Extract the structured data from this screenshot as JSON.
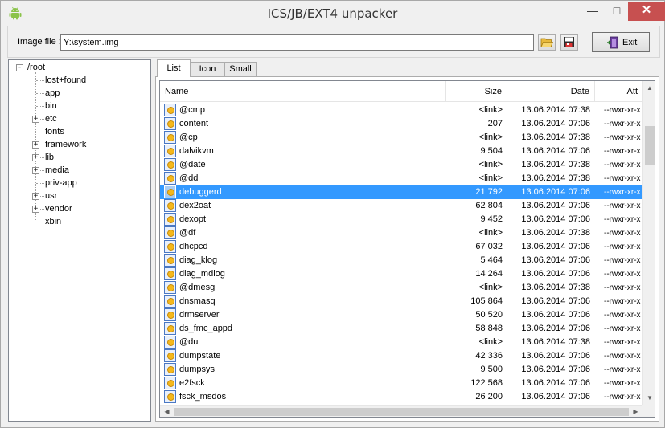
{
  "window": {
    "title": "ICS/JB/EXT4 unpacker",
    "minimize_glyph": "—",
    "maximize_glyph": "□",
    "close_glyph": "✕",
    "app_icon": "android-icon"
  },
  "toolbar": {
    "image_label": "Image file :",
    "image_value": "Y:\\system.img",
    "open_icon": "folder-open-icon",
    "save_icon": "save-icon",
    "exit_label": "Exit",
    "exit_icon": "exit-door-icon"
  },
  "tree": {
    "root": "/root",
    "items": [
      {
        "label": "lost+found",
        "expandable": false
      },
      {
        "label": "app",
        "expandable": false
      },
      {
        "label": "bin",
        "expandable": false
      },
      {
        "label": "etc",
        "expandable": true
      },
      {
        "label": "fonts",
        "expandable": false
      },
      {
        "label": "framework",
        "expandable": true
      },
      {
        "label": "lib",
        "expandable": true
      },
      {
        "label": "media",
        "expandable": true
      },
      {
        "label": "priv-app",
        "expandable": false
      },
      {
        "label": "usr",
        "expandable": true
      },
      {
        "label": "vendor",
        "expandable": true
      },
      {
        "label": "xbin",
        "expandable": false
      }
    ]
  },
  "tabs": [
    {
      "label": "List",
      "active": true
    },
    {
      "label": "Icon",
      "active": false
    },
    {
      "label": "Small",
      "active": false
    }
  ],
  "list": {
    "columns": {
      "name": "Name",
      "size": "Size",
      "date": "Date",
      "attr": "Att"
    },
    "scroll_glyphs": {
      "up": "▲",
      "down": "▼",
      "left": "◀",
      "right": "▶"
    },
    "rows": [
      {
        "name": "@cmp",
        "size": "<link>",
        "date": "13.06.2014 07:38",
        "attr": "--rwxr-xr-x",
        "selected": false
      },
      {
        "name": "content",
        "size": "207",
        "date": "13.06.2014 07:06",
        "attr": "--rwxr-xr-x",
        "selected": false
      },
      {
        "name": "@cp",
        "size": "<link>",
        "date": "13.06.2014 07:38",
        "attr": "--rwxr-xr-x",
        "selected": false
      },
      {
        "name": "dalvikvm",
        "size": "9 504",
        "date": "13.06.2014 07:06",
        "attr": "--rwxr-xr-x",
        "selected": false
      },
      {
        "name": "@date",
        "size": "<link>",
        "date": "13.06.2014 07:38",
        "attr": "--rwxr-xr-x",
        "selected": false
      },
      {
        "name": "@dd",
        "size": "<link>",
        "date": "13.06.2014 07:38",
        "attr": "--rwxr-xr-x",
        "selected": false
      },
      {
        "name": "debuggerd",
        "size": "21 792",
        "date": "13.06.2014 07:06",
        "attr": "--rwxr-xr-x",
        "selected": true
      },
      {
        "name": "dex2oat",
        "size": "62 804",
        "date": "13.06.2014 07:06",
        "attr": "--rwxr-xr-x",
        "selected": false
      },
      {
        "name": "dexopt",
        "size": "9 452",
        "date": "13.06.2014 07:06",
        "attr": "--rwxr-xr-x",
        "selected": false
      },
      {
        "name": "@df",
        "size": "<link>",
        "date": "13.06.2014 07:38",
        "attr": "--rwxr-xr-x",
        "selected": false
      },
      {
        "name": "dhcpcd",
        "size": "67 032",
        "date": "13.06.2014 07:06",
        "attr": "--rwxr-xr-x",
        "selected": false
      },
      {
        "name": "diag_klog",
        "size": "5 464",
        "date": "13.06.2014 07:06",
        "attr": "--rwxr-xr-x",
        "selected": false
      },
      {
        "name": "diag_mdlog",
        "size": "14 264",
        "date": "13.06.2014 07:06",
        "attr": "--rwxr-xr-x",
        "selected": false
      },
      {
        "name": "@dmesg",
        "size": "<link>",
        "date": "13.06.2014 07:38",
        "attr": "--rwxr-xr-x",
        "selected": false
      },
      {
        "name": "dnsmasq",
        "size": "105 864",
        "date": "13.06.2014 07:06",
        "attr": "--rwxr-xr-x",
        "selected": false
      },
      {
        "name": "drmserver",
        "size": "50 520",
        "date": "13.06.2014 07:06",
        "attr": "--rwxr-xr-x",
        "selected": false
      },
      {
        "name": "ds_fmc_appd",
        "size": "58 848",
        "date": "13.06.2014 07:06",
        "attr": "--rwxr-xr-x",
        "selected": false
      },
      {
        "name": "@du",
        "size": "<link>",
        "date": "13.06.2014 07:38",
        "attr": "--rwxr-xr-x",
        "selected": false
      },
      {
        "name": "dumpstate",
        "size": "42 336",
        "date": "13.06.2014 07:06",
        "attr": "--rwxr-xr-x",
        "selected": false
      },
      {
        "name": "dumpsys",
        "size": "9 500",
        "date": "13.06.2014 07:06",
        "attr": "--rwxr-xr-x",
        "selected": false
      },
      {
        "name": "e2fsck",
        "size": "122 568",
        "date": "13.06.2014 07:06",
        "attr": "--rwxr-xr-x",
        "selected": false
      },
      {
        "name": "fsck_msdos",
        "size": "26 200",
        "date": "13.06.2014 07:06",
        "attr": "--rwxr-xr-x",
        "selected": false
      }
    ]
  },
  "colors": {
    "selection": "#3399ff",
    "close_button": "#c75050",
    "android_green": "#8bc34a"
  }
}
